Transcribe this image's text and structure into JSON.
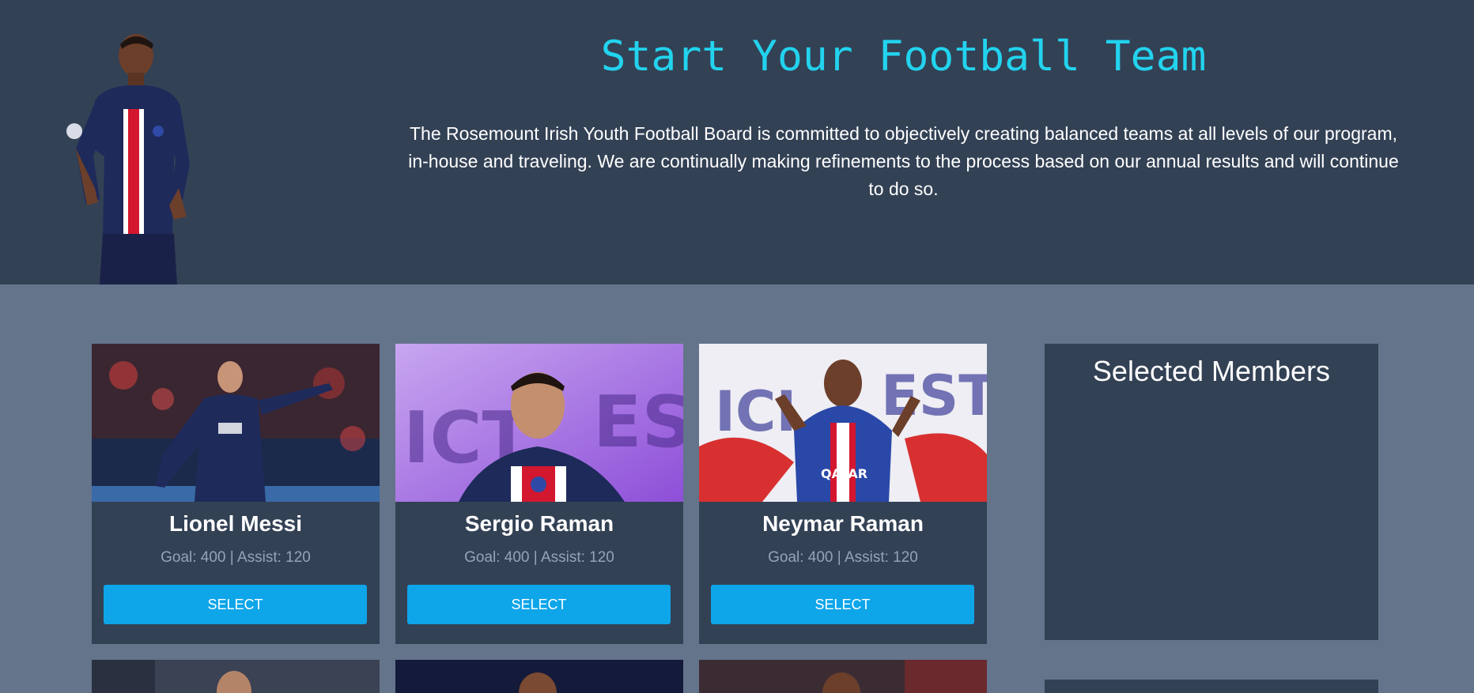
{
  "header": {
    "title": "Start Your Football Team",
    "description": "The Rosemount Irish Youth Football Board is committed to objectively creating balanced teams at all levels of our program, in-house and traveling. We are continually making refinements to the process based on our annual results and will continue to do so."
  },
  "players": [
    {
      "name": "Lionel Messi",
      "stats": "Goal: 400 | Assist: 120",
      "button": "SELECT"
    },
    {
      "name": "Sergio Raman",
      "stats": "Goal: 400 | Assist: 120",
      "button": "SELECT"
    },
    {
      "name": "Neymar Raman",
      "stats": "Goal: 400 | Assist: 120",
      "button": "SELECT"
    }
  ],
  "selected": {
    "title": "Selected Members"
  },
  "colors": {
    "header_bg": "#334155",
    "page_bg": "#64748b",
    "title": "#22d3ee",
    "button": "#0ea5e9",
    "stats": "#94a3b8"
  }
}
